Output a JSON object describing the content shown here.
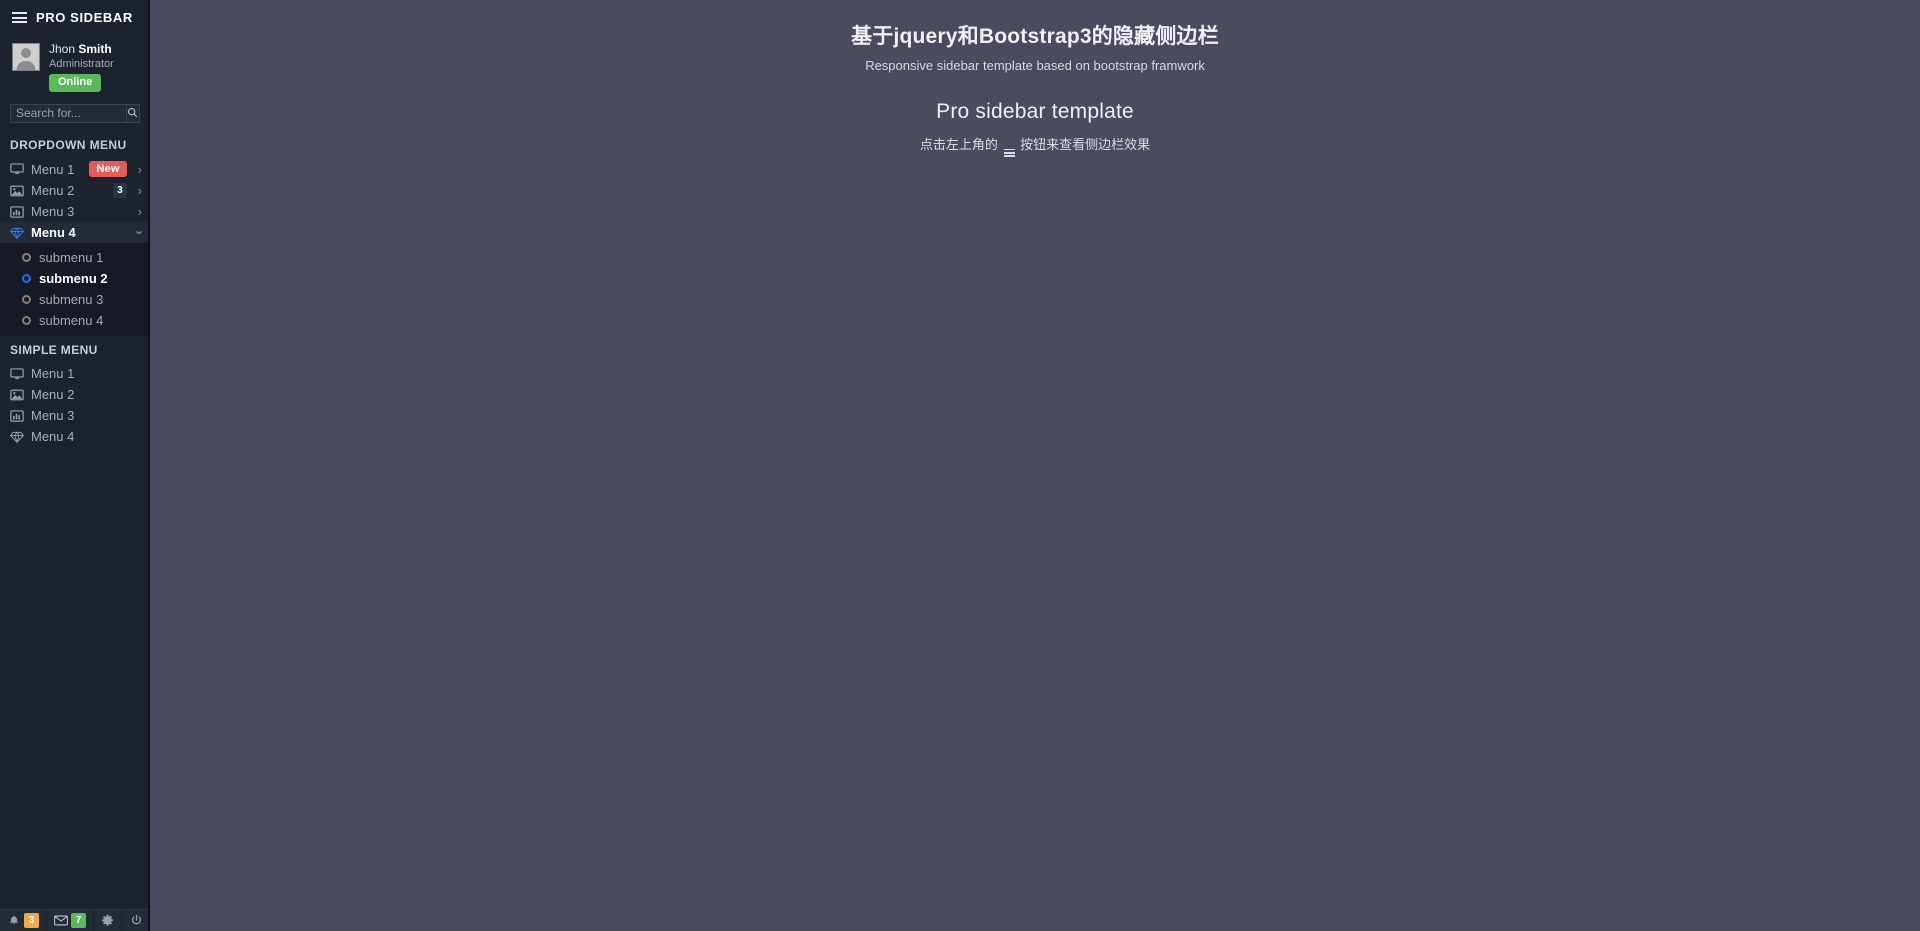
{
  "sidebar": {
    "brand": {
      "title": "PRO SIDEBAR",
      "menu_icon": "hamburger-icon"
    },
    "profile": {
      "first_name": "Jhon ",
      "last_name": "Smith",
      "role": "Administrator",
      "status": "Online",
      "status_color": "#5cb85c",
      "avatar_icon": "user-avatar-icon"
    },
    "search": {
      "placeholder": "Search for...",
      "value": "",
      "button_icon": "search-icon"
    },
    "dropdown_section": {
      "heading": "DROPDOWN MENU",
      "items": [
        {
          "label": "Menu 1",
          "icon": "monitor-icon",
          "badge": "New",
          "badge_type": "new",
          "chevron": "›",
          "expanded": false,
          "active": false
        },
        {
          "label": "Menu 2",
          "icon": "image-icon",
          "badge": "3",
          "badge_type": "count",
          "chevron": "›",
          "expanded": false,
          "active": false
        },
        {
          "label": "Menu 3",
          "icon": "bar-chart-icon",
          "badge": "",
          "badge_type": "none",
          "chevron": "›",
          "expanded": false,
          "active": false
        },
        {
          "label": "Menu 4",
          "icon": "diamond-icon",
          "badge": "",
          "badge_type": "none",
          "chevron": "›",
          "expanded": true,
          "active": true
        }
      ],
      "submenu": [
        {
          "label": "submenu 1",
          "icon": "circle-icon",
          "active": false
        },
        {
          "label": "submenu 2",
          "icon": "circle-icon",
          "active": true
        },
        {
          "label": "submenu 3",
          "icon": "circle-icon",
          "active": false
        },
        {
          "label": "submenu 4",
          "icon": "circle-icon",
          "active": false
        }
      ]
    },
    "simple_section": {
      "heading": "SIMPLE MENU",
      "items": [
        {
          "label": "Menu 1",
          "icon": "monitor-icon"
        },
        {
          "label": "Menu 2",
          "icon": "image-icon"
        },
        {
          "label": "Menu 3",
          "icon": "bar-chart-icon"
        },
        {
          "label": "Menu 4",
          "icon": "diamond-icon"
        }
      ]
    },
    "footer": {
      "bell_icon": "bell-icon",
      "bell_count": "3",
      "bell_color": "#efa84c",
      "mail_icon": "envelope-icon",
      "mail_count": "7",
      "mail_color": "#5cb85c",
      "gear_icon": "gear-icon",
      "power_icon": "power-icon"
    }
  },
  "main": {
    "title": "基于jquery和Bootstrap3的隐藏侧边栏",
    "lead": "Responsive sidebar template based on bootstrap framwork",
    "subtitle": "Pro sidebar template",
    "hint_before": "点击左上角的",
    "hint_after": "按钮来查看侧边栏效果",
    "hint_icon": "hamburger-icon"
  },
  "colors": {
    "sidebar_bg": "#1c222e",
    "sidebar_active_bg": "#232a38",
    "submenu_bg": "#151a24",
    "main_bg": "#4b4b60",
    "accent_blue": "#1b6ef3",
    "badge_new": "#e35b5b",
    "badge_online": "#5cb85c"
  }
}
